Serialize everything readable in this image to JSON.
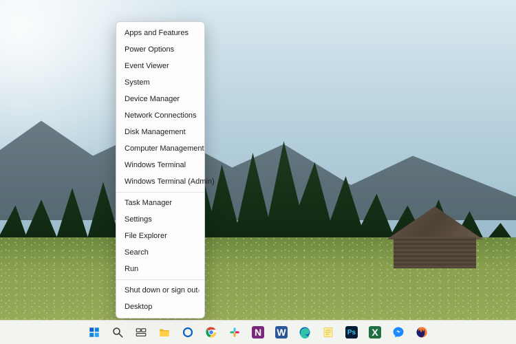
{
  "winx_menu": {
    "groups": [
      [
        "Apps and Features",
        "Power Options",
        "Event Viewer",
        "System",
        "Device Manager",
        "Network Connections",
        "Disk Management",
        "Computer Management",
        "Windows Terminal",
        "Windows Terminal (Admin)"
      ],
      [
        "Task Manager",
        "Settings",
        "File Explorer",
        "Search",
        "Run"
      ],
      [
        {
          "label": "Shut down or sign out",
          "submenu": true
        },
        "Desktop"
      ]
    ]
  },
  "taskbar": {
    "icons": [
      {
        "name": "start",
        "title": "Start"
      },
      {
        "name": "search",
        "title": "Search"
      },
      {
        "name": "task-view",
        "title": "Task View"
      },
      {
        "name": "file-explorer",
        "title": "File Explorer"
      },
      {
        "name": "cortana",
        "title": "Cortana"
      },
      {
        "name": "chrome",
        "title": "Google Chrome"
      },
      {
        "name": "slack",
        "title": "Slack"
      },
      {
        "name": "onenote",
        "title": "OneNote"
      },
      {
        "name": "word",
        "title": "Word"
      },
      {
        "name": "edge",
        "title": "Microsoft Edge"
      },
      {
        "name": "notes",
        "title": "Notes"
      },
      {
        "name": "photoshop",
        "title": "Photoshop"
      },
      {
        "name": "excel",
        "title": "Excel"
      },
      {
        "name": "messenger",
        "title": "Messenger"
      },
      {
        "name": "firefox",
        "title": "Firefox"
      }
    ]
  }
}
